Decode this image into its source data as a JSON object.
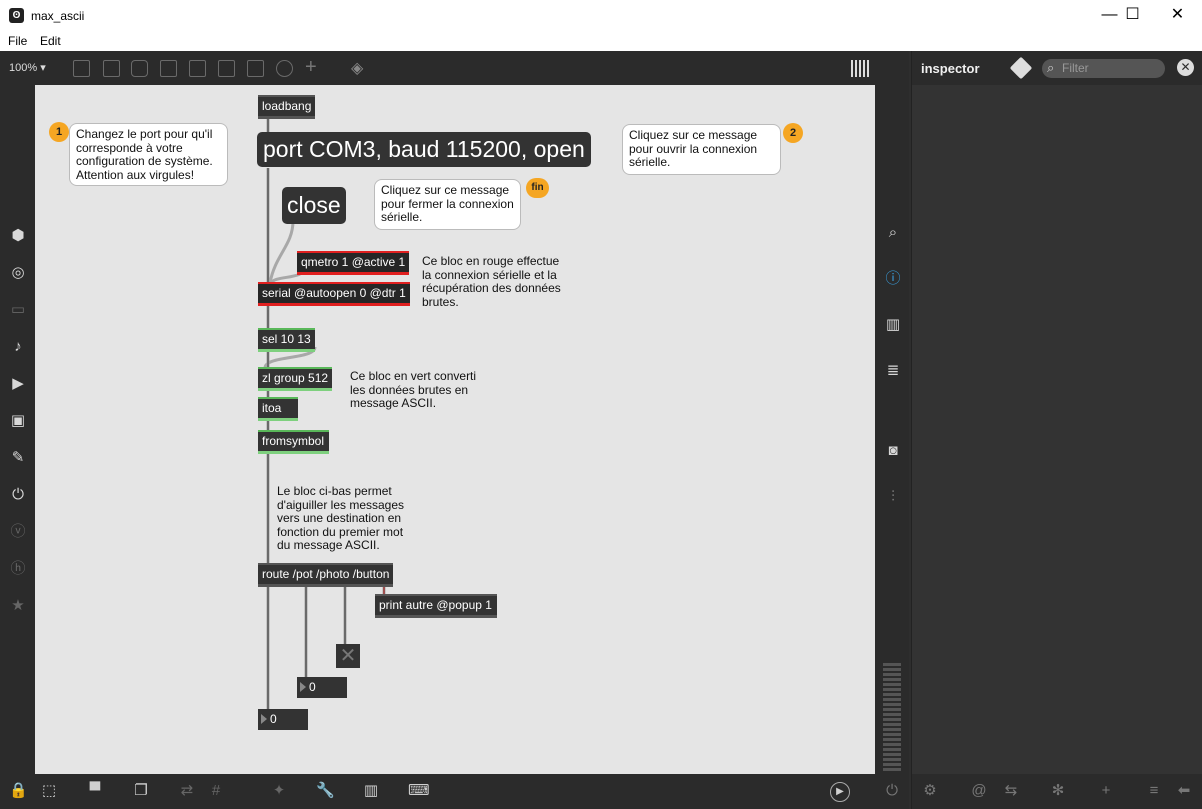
{
  "window": {
    "title": "max_ascii",
    "minimize": "—",
    "maximize": "☐",
    "close": "✕"
  },
  "menu": {
    "file": "File",
    "edit": "Edit"
  },
  "toolbar": {
    "zoom": "100%"
  },
  "inspector": {
    "title": "inspector",
    "filter_placeholder": "Filter"
  },
  "patch": {
    "objects": {
      "loadbang": "loadbang",
      "port_msg": "port COM3, baud 115200, open",
      "close_msg": "close",
      "qmetro": "qmetro 1 @active 1",
      "serial": "serial @autoopen 0 @dtr 1",
      "sel": "sel 10 13",
      "zl": "zl group 512",
      "itoa": "itoa",
      "fromsymbol": "fromsymbol",
      "route": "route /pot /photo /button",
      "print": "print autre @popup 1",
      "num_pot": "0",
      "num_photo": "0"
    },
    "comments": {
      "bubble1_lines": [
        "Changez le port pour qu'il",
        "corresponde à votre",
        "configuration de système.",
        "Attention aux virgules!"
      ],
      "bubble2_lines": [
        "Cliquez sur ce message",
        "pour ouvrir la connexion",
        "sérielle."
      ],
      "bubble_fin_lines": [
        "Cliquez sur ce message",
        "pour fermer la connexion",
        "sérielle."
      ],
      "red_note_lines": [
        "Ce bloc en rouge effectue",
        "la connexion sérielle et la",
        "récupération des données",
        "brutes."
      ],
      "green_note_lines": [
        "Ce bloc en vert converti",
        "les données brutes en",
        "message ASCII."
      ],
      "route_note_lines": [
        "Le bloc ci-bas permet",
        "d'aiguiller les messages",
        "vers une destination en",
        "fonction du premier mot",
        "du message ASCII."
      ]
    },
    "badges": {
      "b1": "1",
      "b2": "2",
      "fin": "fin"
    }
  },
  "colors": {
    "accent": "#f5a623",
    "red_block": "#e02020",
    "green_block": "#59b759",
    "info_blue": "#3aa0e0"
  }
}
